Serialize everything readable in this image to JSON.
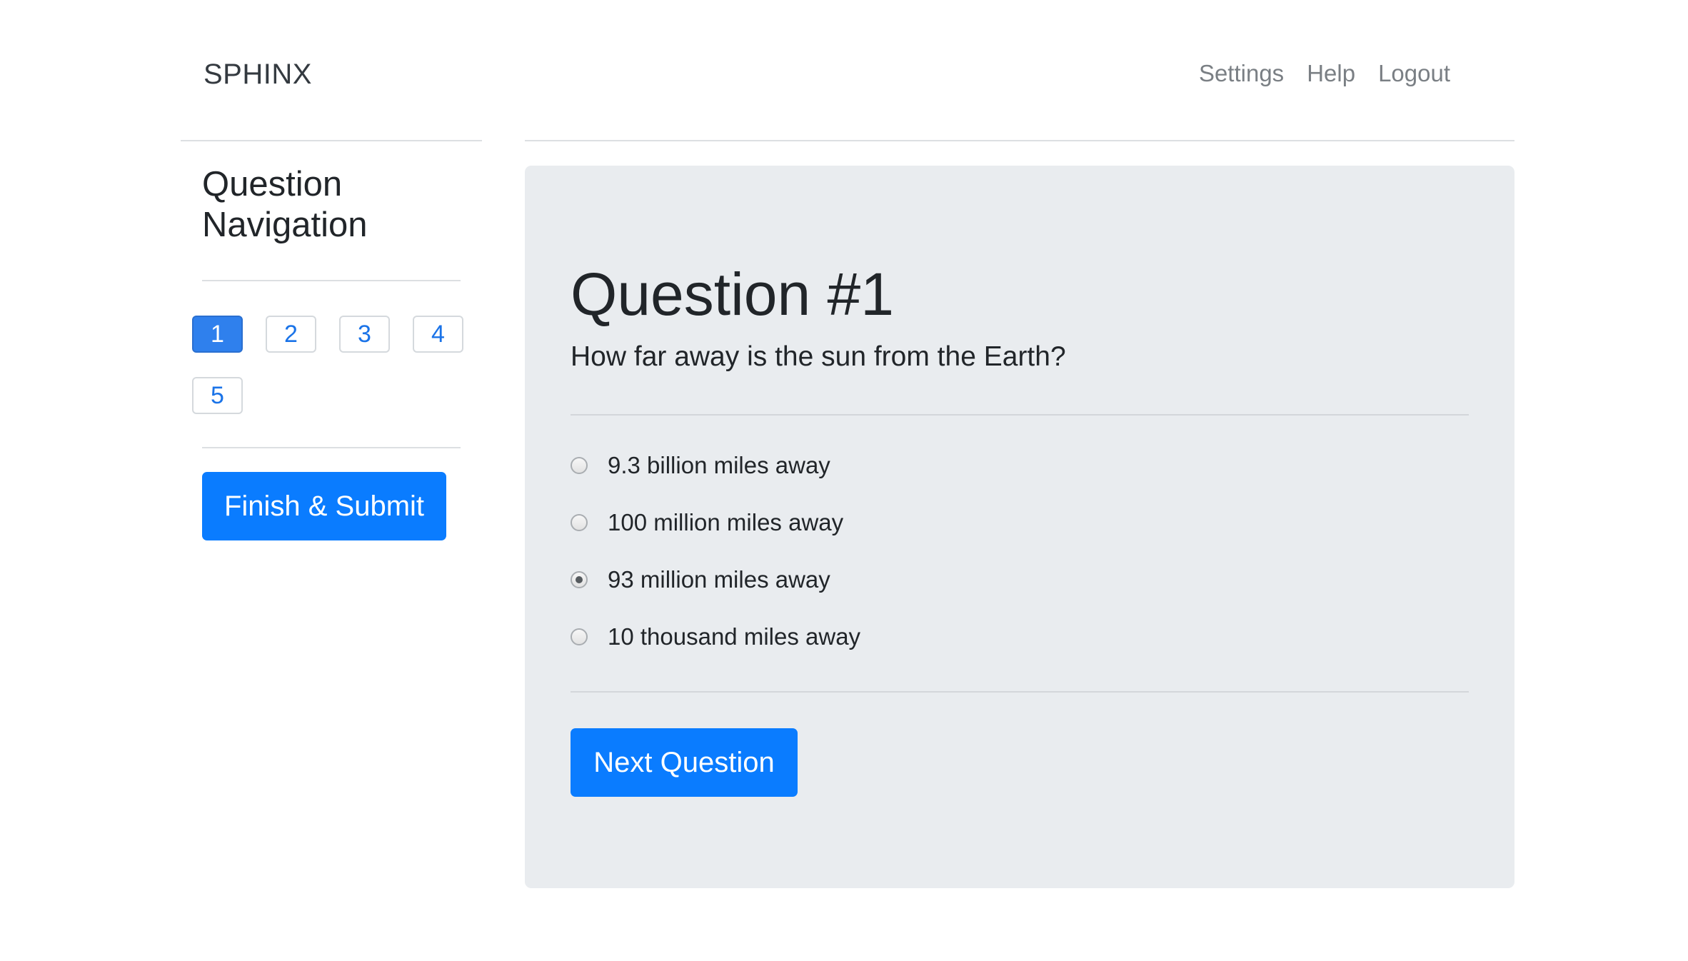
{
  "header": {
    "brand": "SPHINX",
    "nav": [
      "Settings",
      "Help",
      "Logout"
    ]
  },
  "sidebar": {
    "title": "Question Navigation",
    "questions": [
      {
        "label": "1",
        "active": true
      },
      {
        "label": "2",
        "active": false
      },
      {
        "label": "3",
        "active": false
      },
      {
        "label": "4",
        "active": false
      },
      {
        "label": "5",
        "active": false
      }
    ],
    "finish_label": "Finish & Submit"
  },
  "question": {
    "title": "Question #1",
    "text": "How far away is the sun from the Earth?",
    "options": [
      {
        "label": "9.3 billion miles away",
        "selected": false
      },
      {
        "label": "100 million miles away",
        "selected": false
      },
      {
        "label": "93 million miles away",
        "selected": true
      },
      {
        "label": "10 thousand miles away",
        "selected": false
      }
    ],
    "next_label": "Next Question"
  },
  "colors": {
    "accent": "#0a7cff",
    "panel_bg": "#e9ecef",
    "active_nav": "#2f80ed"
  }
}
